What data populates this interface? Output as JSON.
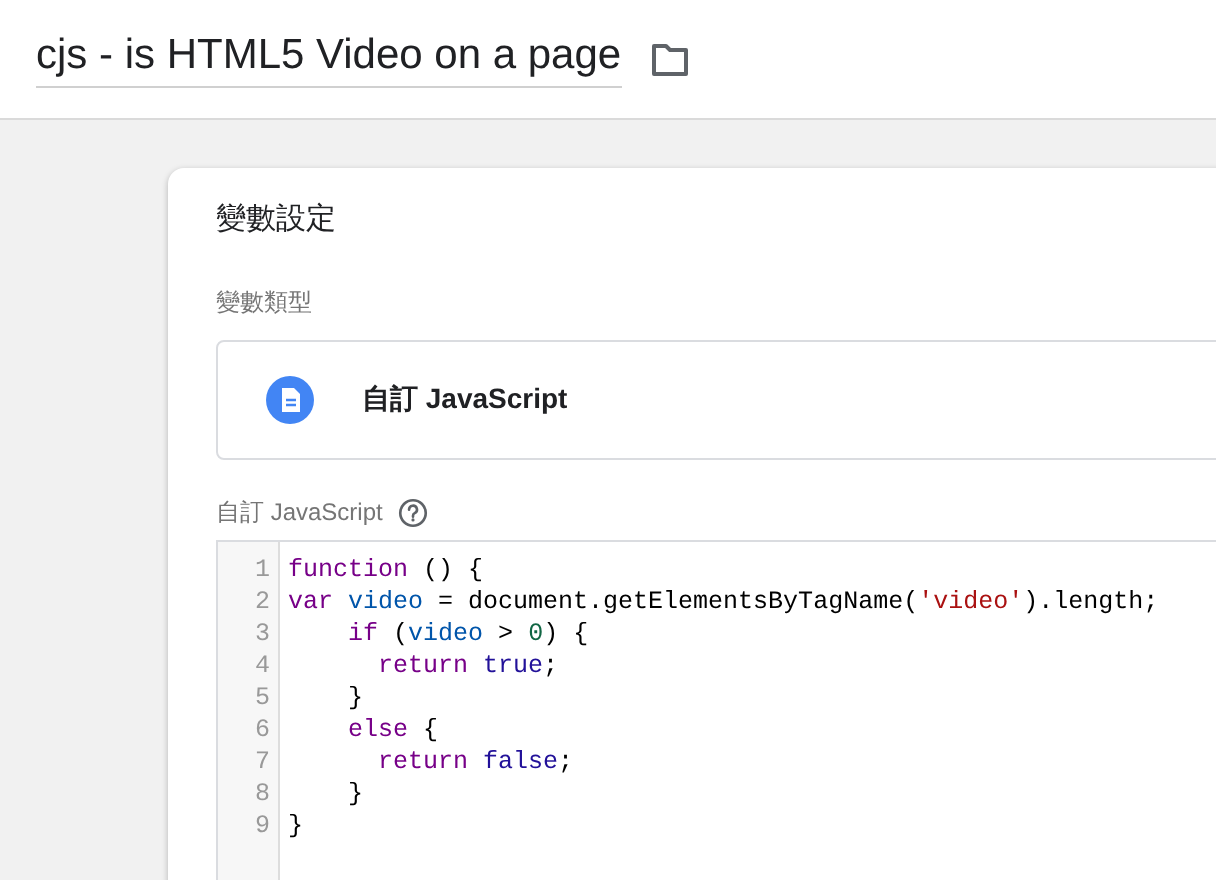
{
  "header": {
    "title": "cjs - is HTML5 Video on a page"
  },
  "card": {
    "title": "變數設定",
    "type_label": "變數類型",
    "type_name": "自訂 JavaScript",
    "code_label": "自訂 JavaScript",
    "code_lines": [
      {
        "number": "1",
        "tokens": [
          {
            "kind": "keyword",
            "text": "function"
          },
          {
            "kind": "plain",
            "text": " () {"
          }
        ]
      },
      {
        "number": "2",
        "tokens": [
          {
            "kind": "keyword",
            "text": "var"
          },
          {
            "kind": "variable",
            "text": " video"
          },
          {
            "kind": "plain",
            "text": " = document.getElementsByTagName("
          },
          {
            "kind": "string",
            "text": "'video'"
          },
          {
            "kind": "plain",
            "text": ").length;"
          }
        ]
      },
      {
        "number": "3",
        "tokens": [
          {
            "kind": "keyword",
            "text": "    if"
          },
          {
            "kind": "plain",
            "text": " ("
          },
          {
            "kind": "variable",
            "text": "video"
          },
          {
            "kind": "plain",
            "text": " > "
          },
          {
            "kind": "number",
            "text": "0"
          },
          {
            "kind": "plain",
            "text": ") {"
          }
        ]
      },
      {
        "number": "4",
        "tokens": [
          {
            "kind": "keyword",
            "text": "      return"
          },
          {
            "kind": "atom",
            "text": " true"
          },
          {
            "kind": "plain",
            "text": ";"
          }
        ]
      },
      {
        "number": "5",
        "tokens": [
          {
            "kind": "plain",
            "text": "    }"
          }
        ]
      },
      {
        "number": "6",
        "tokens": [
          {
            "kind": "keyword",
            "text": "    else"
          },
          {
            "kind": "plain",
            "text": " {"
          }
        ]
      },
      {
        "number": "7",
        "tokens": [
          {
            "kind": "keyword",
            "text": "      return"
          },
          {
            "kind": "atom",
            "text": " false"
          },
          {
            "kind": "plain",
            "text": ";"
          }
        ]
      },
      {
        "number": "8",
        "tokens": [
          {
            "kind": "plain",
            "text": "    }"
          }
        ]
      },
      {
        "number": "9",
        "tokens": [
          {
            "kind": "plain",
            "text": "}"
          }
        ]
      }
    ]
  }
}
